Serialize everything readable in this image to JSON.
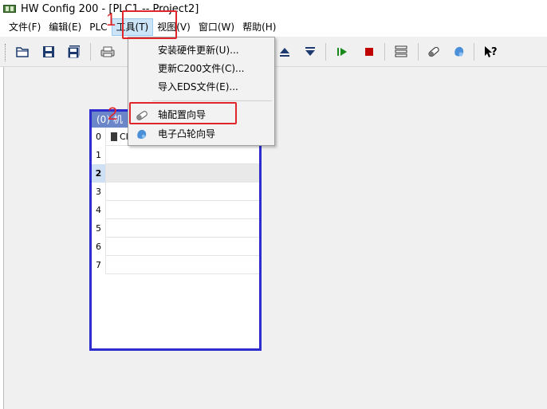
{
  "window": {
    "title": "HW Config 200 - [PLC1 -- Project2]"
  },
  "menubar": {
    "items": [
      "文件(F)",
      "编辑(E)",
      "PLC",
      "工具(T)",
      "视图(V)",
      "窗口(W)",
      "帮助(H)"
    ]
  },
  "tools_menu": {
    "items": [
      "安装硬件更新(U)...",
      "更新C200文件(C)...",
      "导入EDS文件(E)...",
      "轴配置向导",
      "电子凸轮向导"
    ]
  },
  "rack": {
    "header": "(0) 机",
    "slots": [
      "0",
      "1",
      "2",
      "3",
      "4",
      "5",
      "6",
      "7"
    ],
    "slot0_module": "CI",
    "selected_slot": "2"
  },
  "annotations": {
    "step1": "1",
    "step2": "2"
  },
  "colors": {
    "highlight": "#e0262a",
    "rack_border": "#2c2ccf",
    "rack_header": "#6b86c9",
    "menu_active": "#cce4f7"
  },
  "icons": {
    "toolbar": [
      "open-folder-icon",
      "save-icon",
      "save-all-icon",
      "print-icon",
      "upload-icon",
      "download-icon",
      "run-icon",
      "stop-icon",
      "module-list-icon",
      "axis-wizard-icon",
      "cam-wizard-icon",
      "help-icon"
    ]
  }
}
